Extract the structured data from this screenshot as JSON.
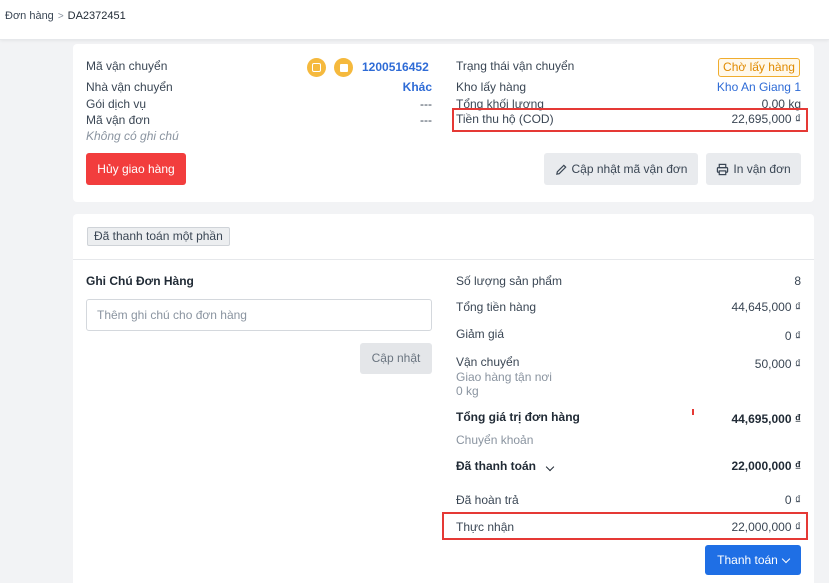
{
  "breadcrumb": {
    "root": "Đơn hàng",
    "separator": ">",
    "current": "DA2372451"
  },
  "shipping": {
    "tracking_label": "Mã vận chuyển",
    "tracking_value": "1200516452",
    "carrier_label": "Nhà vận chuyển",
    "carrier_value": "Khác",
    "service_label": "Gói dịch vụ",
    "service_value": "---",
    "waybill_label": "Mã vận đơn",
    "waybill_value": "---",
    "no_note": "Không có ghi chú",
    "status_label": "Trạng thái vận chuyển",
    "status_value": "Chờ lấy hàng",
    "warehouse_label": "Kho lấy hàng",
    "warehouse_value": "Kho An Giang 1",
    "weight_label": "Tổng khối lượng",
    "weight_value": "0.00 kg",
    "cod_label": "Tiền thu hộ (COD)",
    "cod_value": "22,695,000 ₫",
    "cancel_button": "Hủy giao hàng",
    "update_waybill_button": "Cập nhật mã vận đơn",
    "print_waybill_button": "In vận đơn"
  },
  "order": {
    "payment_tag": "Đã thanh toán một phần",
    "note_title": "Ghi Chú Đơn Hàng",
    "note_placeholder": "Thêm ghi chú cho đơn hàng",
    "note_update_button": "Cập nhật",
    "qty_label": "Số lượng sản phẩm",
    "qty_value": "8",
    "subtotal_label": "Tổng tiền hàng",
    "subtotal_value": "44,645,000 ₫",
    "discount_label": "Giảm giá",
    "discount_value": "0 ₫",
    "shipping_label": "Vận chuyển",
    "shipping_value": "50,000 ₫",
    "shipping_method": "Giao hàng tận nơi",
    "shipping_weight": "0 kg",
    "total_label": "Tổng giá trị đơn hàng",
    "total_value": "44,695,000 ₫",
    "transfer_label": "Chuyển khoản",
    "paid_label": "Đã thanh toán",
    "paid_value": "22,000,000 ₫",
    "refunded_label": "Đã hoàn trả",
    "refunded_value": "0 ₫",
    "received_label": "Thực nhận",
    "received_value": "22,000,000 ₫",
    "pay_button": "Thanh toán"
  },
  "colors": {
    "accent_blue": "#1f6fe5",
    "link_blue": "#2e6bd6",
    "danger_red": "#f23d3d",
    "highlight_red": "#e53935",
    "warning_orange": "#f0ad2e"
  },
  "icons": [
    "clipboard-icon",
    "box-icon",
    "pencil-icon",
    "printer-icon",
    "chevron-down-icon"
  ]
}
